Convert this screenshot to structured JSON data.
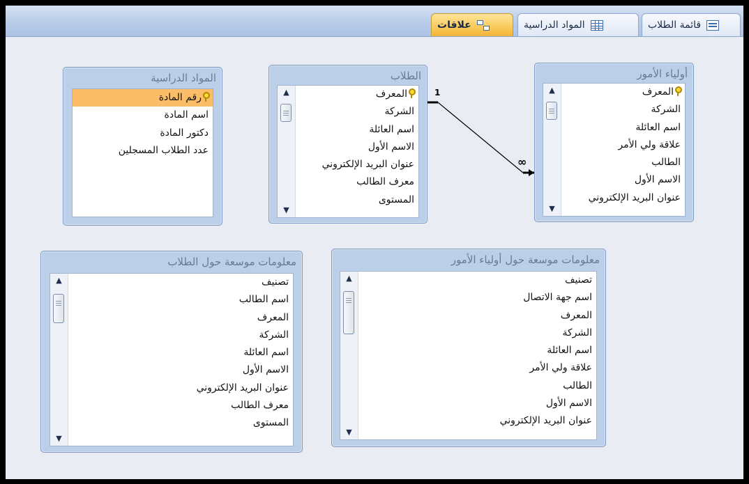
{
  "tabs": [
    {
      "label": "قائمة الطلاب",
      "icon": "form-icon",
      "active": false
    },
    {
      "label": "المواد الدراسية",
      "icon": "table-icon",
      "active": false
    },
    {
      "label": "علاقات",
      "icon": "relationships-icon",
      "active": true
    }
  ],
  "tables": {
    "courses": {
      "title": "المواد الدراسية",
      "fields": [
        "رقم المادة",
        "اسم المادة",
        "دكتور المادة",
        "عدد الطلاب المسجلين"
      ]
    },
    "students": {
      "title": "الطلاب",
      "fields": [
        "المعرف",
        "الشركة",
        "اسم العائلة",
        "الاسم الأول",
        "عنوان البريد الإلكتروني",
        "معرف الطالب",
        "المستوى"
      ]
    },
    "guardians": {
      "title": "أولياء الأمور",
      "fields": [
        "المعرف",
        "الشركة",
        "اسم العائلة",
        "علاقة ولي الأمر",
        "الطالب",
        "الاسم الأول",
        "عنوان البريد الإلكتروني"
      ]
    },
    "students_ext": {
      "title": "معلومات موسعة حول الطلاب",
      "fields": [
        "تصنيف",
        "اسم الطالب",
        "المعرف",
        "الشركة",
        "اسم العائلة",
        "الاسم الأول",
        "عنوان البريد الإلكتروني",
        "معرف الطالب",
        "المستوى"
      ]
    },
    "guardians_ext": {
      "title": "معلومات موسعة حول أولياء الأمور",
      "fields": [
        "تصنيف",
        "اسم جهة الاتصال",
        "المعرف",
        "الشركة",
        "اسم العائلة",
        "علاقة ولي الأمر",
        "الطالب",
        "الاسم الأول",
        "عنوان البريد الإلكتروني"
      ]
    }
  },
  "relationship": {
    "one_label": "1",
    "many_label": "∞"
  },
  "colors": {
    "active_tab": "#f8c550",
    "selected_field": "#fbbd68",
    "table_frame": "#bccfe9",
    "canvas": "#e9ecf3"
  }
}
